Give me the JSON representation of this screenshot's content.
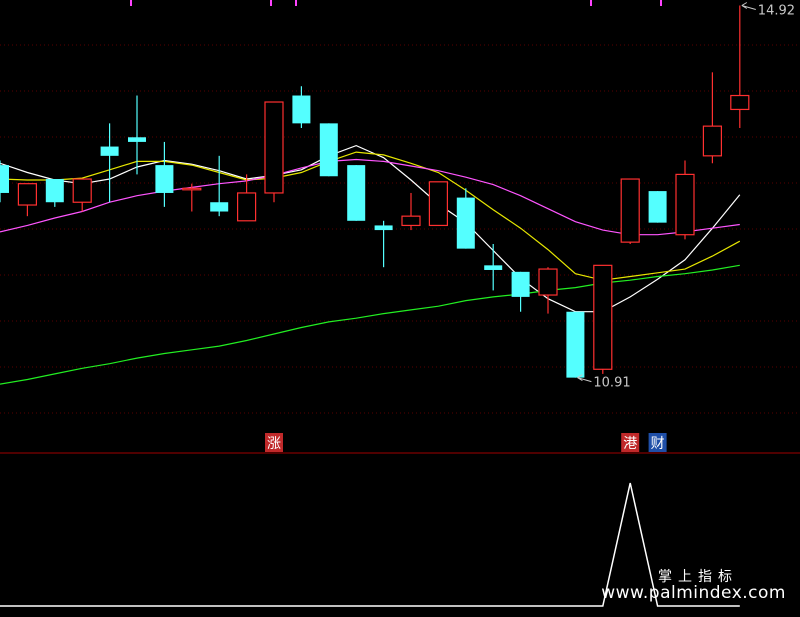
{
  "chart_data": {
    "type": "candlestick",
    "title": "",
    "xlabel": "",
    "ylabel": "",
    "ylim": [
      10.0,
      15.0
    ],
    "grid": true,
    "candles": [
      {
        "open": 13.2,
        "high": 13.25,
        "low": 12.8,
        "close": 12.9
      },
      {
        "open": 12.77,
        "high": 13.0,
        "low": 12.65,
        "close": 13.0
      },
      {
        "open": 13.05,
        "high": 13.05,
        "low": 12.75,
        "close": 12.8
      },
      {
        "open": 12.8,
        "high": 13.05,
        "low": 12.7,
        "close": 13.05
      },
      {
        "open": 13.4,
        "high": 13.65,
        "low": 12.8,
        "close": 13.3
      },
      {
        "open": 13.5,
        "high": 13.95,
        "low": 13.1,
        "close": 13.45
      },
      {
        "open": 13.2,
        "high": 13.45,
        "low": 12.75,
        "close": 12.9
      },
      {
        "open": 12.95,
        "high": 13.0,
        "low": 12.7,
        "close": 12.95
      },
      {
        "open": 12.8,
        "high": 13.3,
        "low": 12.65,
        "close": 12.7
      },
      {
        "open": 12.6,
        "high": 13.1,
        "low": 12.6,
        "close": 12.9
      },
      {
        "open": 12.9,
        "high": 13.88,
        "low": 12.8,
        "close": 13.88
      },
      {
        "open": 13.95,
        "high": 14.05,
        "low": 13.6,
        "close": 13.65
      },
      {
        "open": 13.65,
        "high": 13.65,
        "low": 13.08,
        "close": 13.08
      },
      {
        "open": 13.2,
        "high": 13.2,
        "low": 12.6,
        "close": 12.6
      },
      {
        "open": 12.55,
        "high": 12.6,
        "low": 12.1,
        "close": 12.5
      },
      {
        "open": 12.55,
        "high": 12.9,
        "low": 12.5,
        "close": 12.65
      },
      {
        "open": 12.55,
        "high": 13.02,
        "low": 12.55,
        "close": 13.02
      },
      {
        "open": 12.85,
        "high": 12.95,
        "low": 12.3,
        "close": 12.3
      },
      {
        "open": 12.12,
        "high": 12.35,
        "low": 11.85,
        "close": 12.07
      },
      {
        "open": 12.05,
        "high": 12.05,
        "low": 11.62,
        "close": 11.78
      },
      {
        "open": 11.8,
        "high": 12.1,
        "low": 11.6,
        "close": 12.08
      },
      {
        "open": 11.62,
        "high": 11.62,
        "low": 10.91,
        "close": 10.91
      },
      {
        "open": 11.0,
        "high": 12.1,
        "low": 10.95,
        "close": 12.12
      },
      {
        "open": 12.37,
        "high": 13.05,
        "low": 12.35,
        "close": 13.05
      },
      {
        "open": 12.92,
        "high": 12.92,
        "low": 12.58,
        "close": 12.58
      },
      {
        "open": 12.45,
        "high": 13.25,
        "low": 12.4,
        "close": 13.1
      },
      {
        "open": 13.3,
        "high": 14.2,
        "low": 13.22,
        "close": 13.62
      },
      {
        "open": 13.8,
        "high": 14.92,
        "low": 13.6,
        "close": 13.95
      }
    ],
    "ma_lines": [
      {
        "color": "#ffffff",
        "values": [
          13.22,
          13.12,
          13.04,
          13.0,
          13.05,
          13.18,
          13.25,
          13.21,
          13.14,
          13.05,
          13.09,
          13.15,
          13.3,
          13.41,
          13.28,
          13.04,
          12.78,
          12.58,
          12.28,
          11.98,
          11.76,
          11.62,
          11.62,
          11.78,
          11.97,
          12.18,
          12.52,
          12.88
        ]
      },
      {
        "color": "#e6e600",
        "values": [
          13.05,
          13.04,
          13.04,
          13.06,
          13.15,
          13.24,
          13.24,
          13.2,
          13.12,
          13.04,
          13.06,
          13.12,
          13.24,
          13.34,
          13.31,
          13.22,
          13.12,
          12.93,
          12.72,
          12.52,
          12.29,
          12.03,
          11.96,
          12.0,
          12.04,
          12.08,
          12.22,
          12.38
        ]
      },
      {
        "color": "#ff55ff",
        "values": [
          12.48,
          12.55,
          12.63,
          12.7,
          12.8,
          12.87,
          12.92,
          12.96,
          13.0,
          13.03,
          13.09,
          13.17,
          13.24,
          13.26,
          13.24,
          13.19,
          13.14,
          13.07,
          12.99,
          12.87,
          12.73,
          12.59,
          12.5,
          12.45,
          12.45,
          12.48,
          12.52,
          12.56
        ]
      },
      {
        "color": "#22ee22",
        "values": [
          10.84,
          10.89,
          10.95,
          11.01,
          11.06,
          11.12,
          11.17,
          11.21,
          11.25,
          11.31,
          11.38,
          11.45,
          11.51,
          11.55,
          11.6,
          11.64,
          11.68,
          11.74,
          11.78,
          11.81,
          11.85,
          11.88,
          11.93,
          11.96,
          12.0,
          12.03,
          12.07,
          12.12
        ]
      }
    ],
    "extreme_labels": [
      {
        "text": "14.92",
        "candle": 27,
        "value": 14.92
      },
      {
        "text": "10.91",
        "candle": 21,
        "value": 10.91
      }
    ],
    "signal_tags": [
      {
        "text": "涨",
        "candle": 10,
        "color": "#c0292a"
      },
      {
        "text": "港",
        "candle": 23,
        "color": "#c0292a"
      },
      {
        "text": "财",
        "candle": 24,
        "color": "#1f4fa8"
      }
    ],
    "indicator": {
      "type": "line",
      "color": "#ffffff",
      "ylim": [
        0,
        1
      ],
      "values": [
        0,
        0,
        0,
        0,
        0,
        0,
        0,
        0,
        0,
        0,
        0,
        0,
        0,
        0,
        0,
        0,
        0,
        0,
        0,
        0,
        0,
        0,
        0,
        1,
        0,
        0,
        0,
        0
      ]
    },
    "colors": {
      "up": "#ff3030",
      "down": "#54ffff",
      "top_ticks": "#ff44ff",
      "grid": "#5a0000",
      "axis_line": "#a00000"
    }
  },
  "watermark": {
    "cn": "掌上指标",
    "url": "www.palmindex.com"
  }
}
